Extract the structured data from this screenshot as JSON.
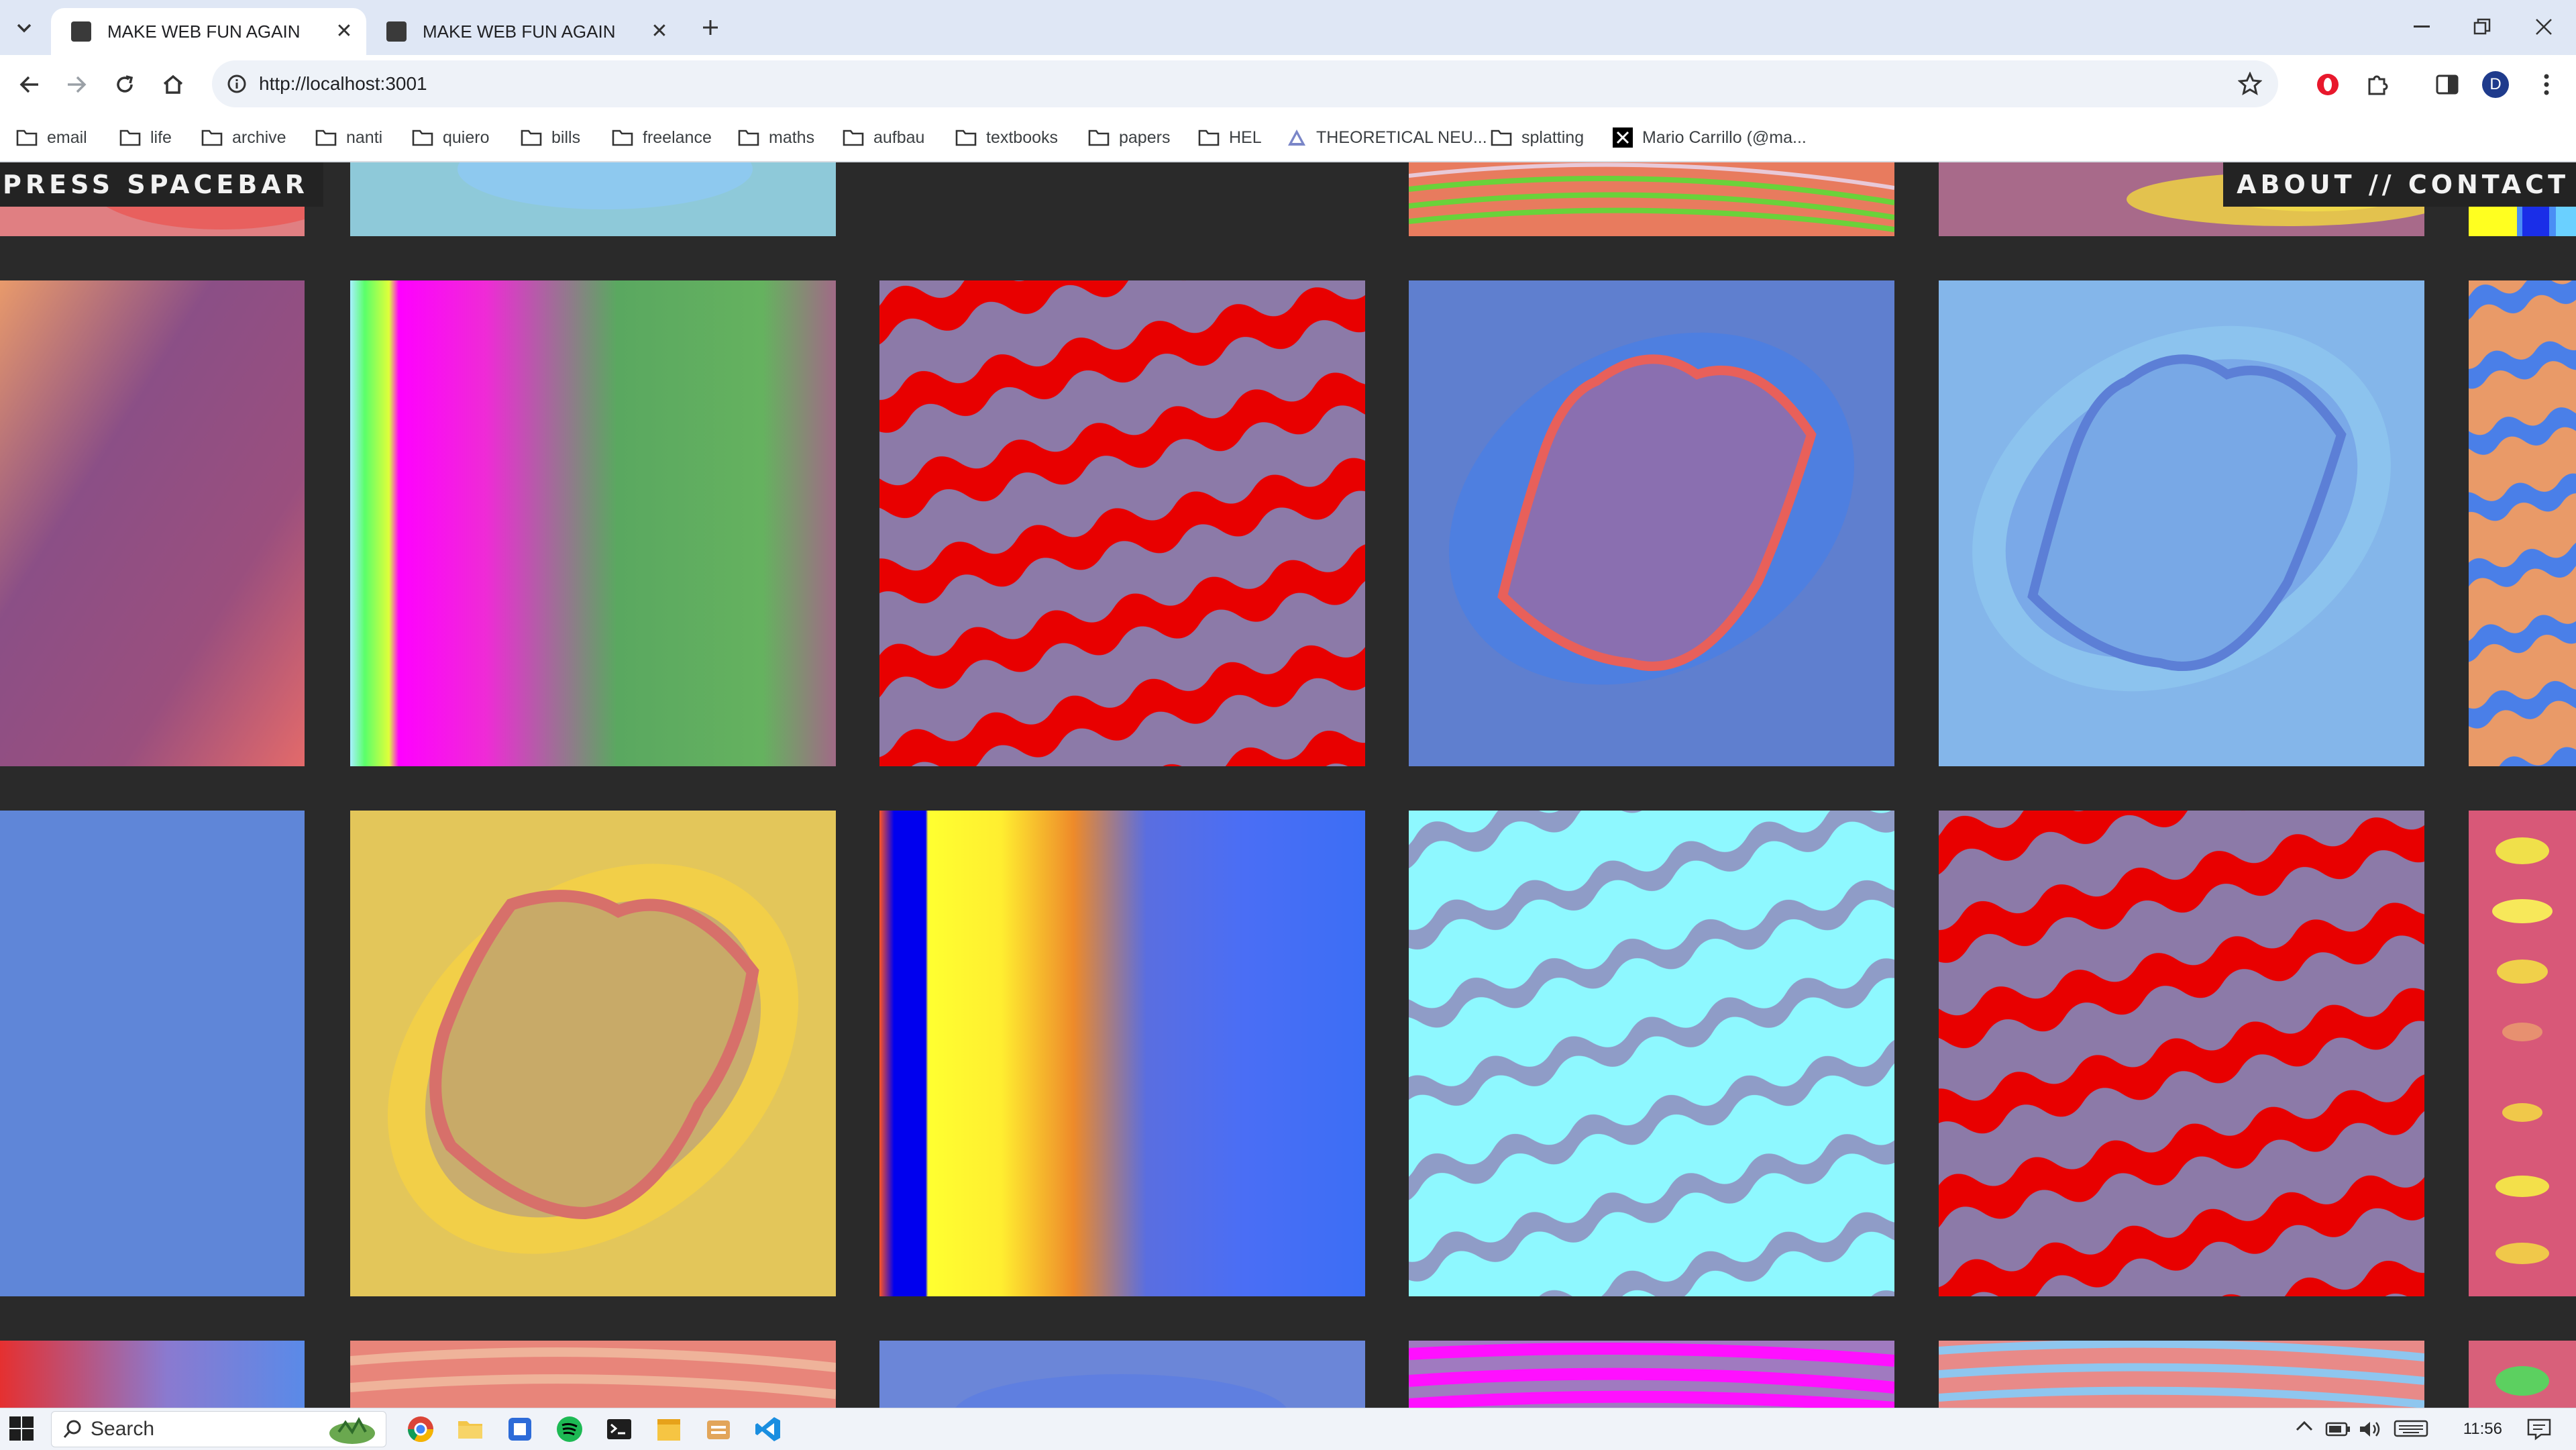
{
  "browser": {
    "tabs": [
      {
        "title": "MAKE WEB FUN AGAIN",
        "active": true
      },
      {
        "title": "MAKE WEB FUN AGAIN",
        "active": false
      }
    ],
    "url": "http://localhost:3001",
    "profile_initial": "D",
    "bookmarks": [
      {
        "label": "email",
        "icon": "folder-icon"
      },
      {
        "label": "life",
        "icon": "folder-icon"
      },
      {
        "label": "archive",
        "icon": "folder-icon"
      },
      {
        "label": "nanti",
        "icon": "folder-icon"
      },
      {
        "label": "quiero",
        "icon": "folder-icon"
      },
      {
        "label": "bills",
        "icon": "folder-icon"
      },
      {
        "label": "freelance",
        "icon": "folder-icon"
      },
      {
        "label": "maths",
        "icon": "folder-icon"
      },
      {
        "label": "aufbau",
        "icon": "folder-icon"
      },
      {
        "label": "textbooks",
        "icon": "folder-icon"
      },
      {
        "label": "papers",
        "icon": "folder-icon"
      },
      {
        "label": "HEL",
        "icon": "folder-icon"
      },
      {
        "label": "THEORETICAL NEU...",
        "icon": "triangle-site-icon"
      },
      {
        "label": "splatting",
        "icon": "folder-icon"
      },
      {
        "label": "Mario Carrillo (@ma...",
        "icon": "x-logo-icon"
      }
    ]
  },
  "page": {
    "press_label": "PRESS SPACEBAR",
    "nav": {
      "about": "ABOUT",
      "separator": " // ",
      "contact": "CONTACT"
    }
  },
  "taskbar": {
    "search_placeholder": "Search",
    "time": "11:56"
  },
  "colors": {
    "page_background": "#2a2a2a",
    "tab_strip": "#dfe7f5",
    "active_tab": "#ffffff"
  }
}
